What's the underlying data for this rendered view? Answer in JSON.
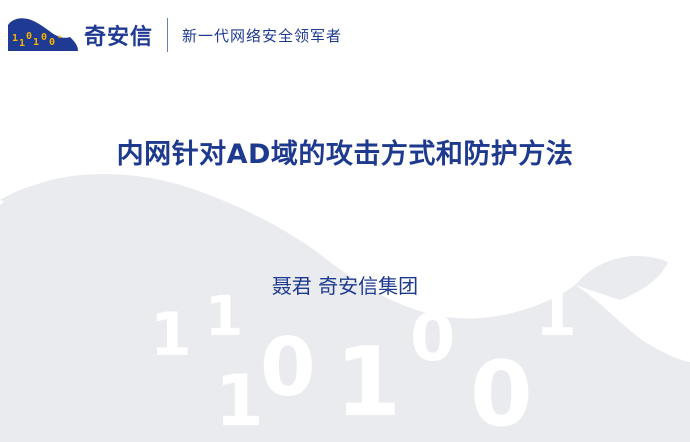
{
  "header": {
    "logo_text": "奇安信",
    "logo_icon": "lion-binary-logo-icon",
    "tagline": "新一代网络安全领军者"
  },
  "title": "内网针对AD域的攻击方式和防护方法",
  "author": "聂君 奇安信集团",
  "watermark_icon": "lion-watermark-icon",
  "colors": {
    "brand_blue": "#1f3a93",
    "logo_yellow": "#f5b400",
    "watermark_gray": "#e9ebef"
  }
}
